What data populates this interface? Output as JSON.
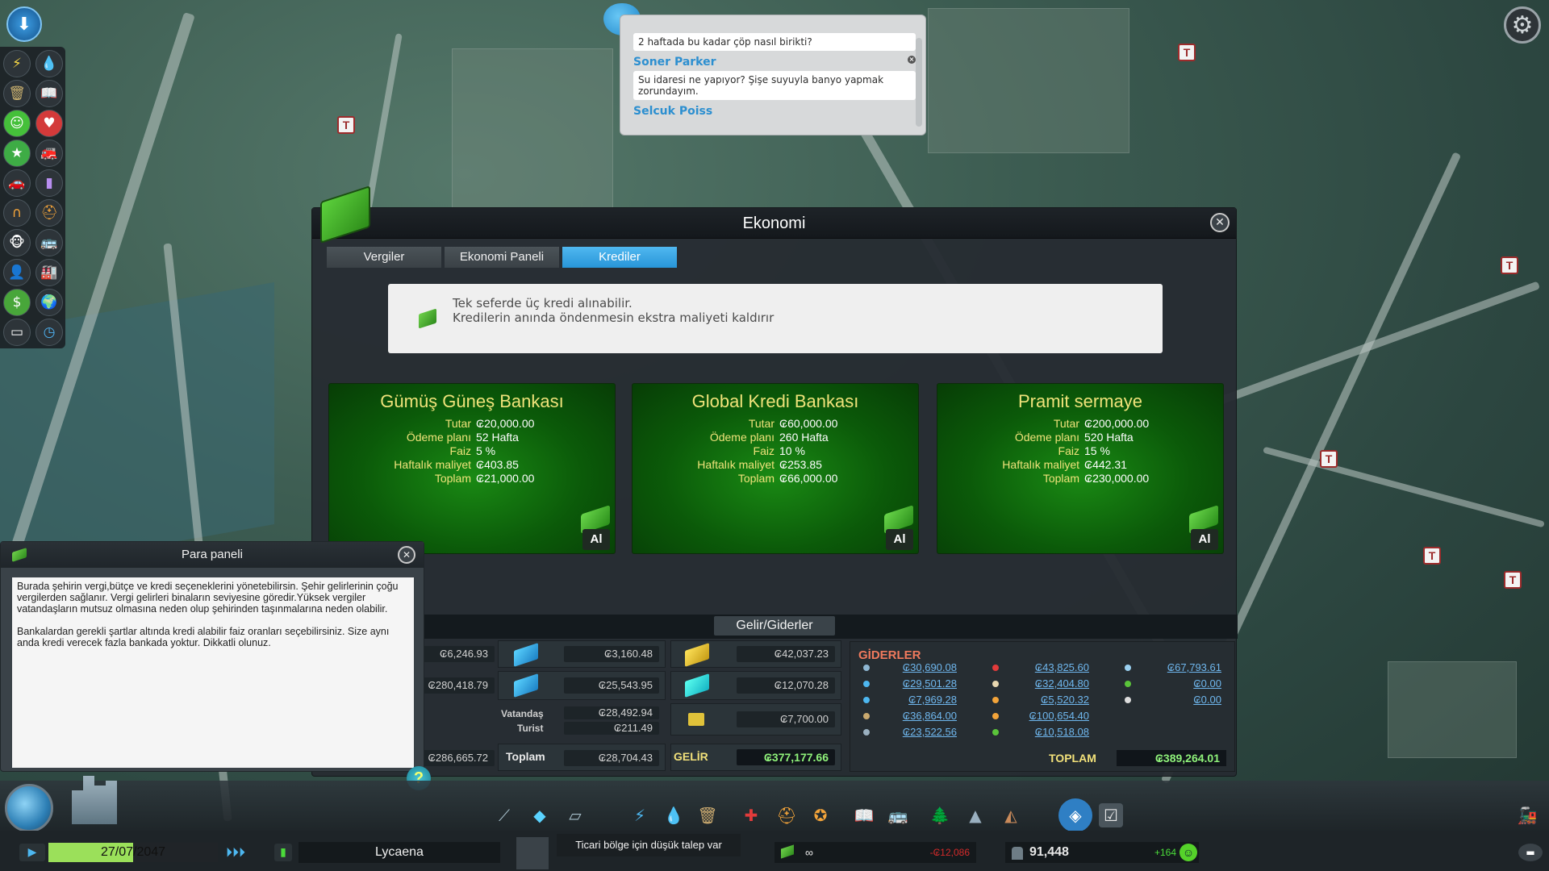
{
  "chirper": {
    "messages": [
      {
        "name": "",
        "text": "2 haftada bu kadar çöp nasıl birikti?"
      },
      {
        "name": "Soner Parker",
        "text": "Su idaresi ne yapıyor? Şişe suyuyla banyo yapmak zorundayım."
      },
      {
        "name": "Selcuk Poiss",
        "text": ""
      }
    ]
  },
  "economy": {
    "title": "Ekonomi",
    "tabs": [
      "Vergiler",
      "Ekonomi Paneli",
      "Krediler"
    ],
    "active_tab": "Krediler",
    "info_line1": "Tek seferde üç kredi alınabilir.",
    "info_line2": "Kredilerin anında öndenmesin ekstra maliyeti kaldırır",
    "loan_labels": {
      "amount": "Tutar",
      "plan": "Ödeme planı",
      "interest": "Faiz",
      "weekly": "Haftalık maliyet",
      "total": "Toplam"
    },
    "banks": [
      {
        "name": "Gümüş Güneş Bankası",
        "amount": "₢20,000.00",
        "plan": "52 Hafta",
        "interest": "5 %",
        "weekly": "₢403.85",
        "total": "₢21,000.00",
        "buy": "Al"
      },
      {
        "name": "Global Kredi Bankası",
        "amount": "₢60,000.00",
        "plan": "260 Hafta",
        "interest": "10 %",
        "weekly": "₢253.85",
        "total": "₢66,000.00",
        "buy": "Al"
      },
      {
        "name": "Pramit sermaye",
        "amount": "₢200,000.00",
        "plan": "520 Hafta",
        "interest": "15 %",
        "weekly": "₢442.31",
        "total": "₢230,000.00",
        "buy": "Al"
      }
    ],
    "income_expense_title": "Gelir/Giderler",
    "income": {
      "col1": [
        "₢6,246.93",
        "₢280,418.79",
        "₢286,665.72"
      ],
      "col2": [
        "₢3,160.48",
        "₢25,543.95"
      ],
      "citizen_label": "Vatandaş",
      "citizen_value": "₢28,492.94",
      "tourist_label": "Turist",
      "tourist_value": "₢211.49",
      "total_label": "Toplam",
      "col2_total": "₢28,704.43",
      "col3": [
        "₢42,037.23",
        "₢12,070.28",
        "₢7,700.00"
      ],
      "gelir_label": "GELİR",
      "gelir_value": "₢377,177.66"
    },
    "expenses": {
      "title": "GİDERLER",
      "col1": [
        "₢30,690.08",
        "₢29,501.28",
        "₢7,969.28",
        "₢36,864.00",
        "₢23,522.56"
      ],
      "col2": [
        "₢43,825.60",
        "₢32,404.80",
        "₢5,520.32",
        "₢100,654.40",
        "₢10,518.08"
      ],
      "col3": [
        "₢67,793.61",
        "₢0.00",
        "₢0.00"
      ],
      "total_label": "TOPLAM",
      "total_value": "₢389,264.01"
    }
  },
  "para_panel": {
    "title": "Para paneli",
    "para1": "Burada şehirin vergi,bütçe ve kredi seçeneklerini yönetebilirsin. Şehir gelirlerinin çoğu vergilerden sağlanır. Vergi gelirleri binaların seviyesine göredir.Yüksek vergiler vatandaşların mutsuz olmasına neden olup şehirinden taşınmalarına neden olabilir.",
    "para2": "Bankalardan gerekli şartlar altında kredi alabilir faiz oranları seçebilirsiniz. Size aynı anda kredi verecek fazla bankada yoktur. Dikkatli olunuz."
  },
  "status_bar": {
    "date": "27/07/2047",
    "city_name": "Lycaena",
    "tooltip": "Ticari bölge için düşük talep var",
    "money": "∞",
    "money_change": "-₢12,086",
    "population": "91,448",
    "population_change": "+164"
  },
  "colors": {
    "accent_blue": "#2895d8",
    "bank_title": "#f0e37a",
    "expense_title": "#f07a5d",
    "income_total": "#8ff27a"
  }
}
